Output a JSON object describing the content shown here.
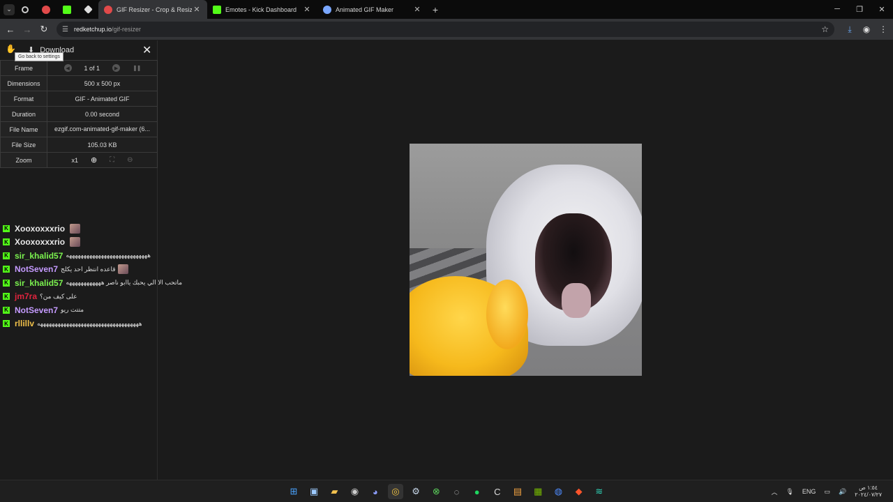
{
  "browser": {
    "tabs": [
      {
        "title": "GIF Resizer - Crop & Resize Anim",
        "active": true,
        "favicon_color": "#e14a4a"
      },
      {
        "title": "Emotes - Kick Dashboard",
        "active": false,
        "favicon_color": "#53fc18"
      },
      {
        "title": "Animated GIF Maker",
        "active": false,
        "favicon_color": "#7aa7ff"
      }
    ],
    "tab_close": "✕",
    "new_tab": "+",
    "url_host": "redketchup.io",
    "url_path": "/gif-resizer"
  },
  "panel": {
    "download_label": "Download",
    "tooltip": "Go back to settings",
    "rows": {
      "frame": {
        "label": "Frame",
        "value": "1 of 1"
      },
      "dimensions": {
        "label": "Dimensions",
        "value": "500 x 500 px"
      },
      "format": {
        "label": "Format",
        "value": "GIF - Animated GIF"
      },
      "duration": {
        "label": "Duration",
        "value": "0.00 second"
      },
      "filename": {
        "label": "File Name",
        "value": "ezgif.com-animated-gif-maker (6..."
      },
      "filesize": {
        "label": "File Size",
        "value": "105.03 KB"
      },
      "zoom": {
        "label": "Zoom",
        "value": "x1"
      }
    }
  },
  "chat": [
    {
      "user": "Xooxoxxxrio",
      "color": "#e8e8e8",
      "message": "",
      "emote": true
    },
    {
      "user": "Xooxoxxxrio",
      "color": "#e8e8e8",
      "message": "",
      "emote": true
    },
    {
      "user": "sir_khalid57",
      "color": "#7bf24f",
      "message": "ههههههههههههههههههههههههههههه",
      "emote": false
    },
    {
      "user": "NotSeven7",
      "color": "#c59bff",
      "message": "قاعده انتظر احد يكلج",
      "emote": true
    },
    {
      "user": "sir_khalid57",
      "color": "#7bf24f",
      "message": "ماتحب الا الي يحبك ياابو ناصر ههههههههههههه",
      "emote": false
    },
    {
      "user": "jm7ra",
      "color": "#e0243e",
      "message": "على كيف من؟",
      "emote": false
    },
    {
      "user": "NotSeven7",
      "color": "#c59bff",
      "message": "متتت ريو",
      "emote": false
    },
    {
      "user": "rllillv",
      "color": "#f0c04a",
      "message": "هههههههههههههههههههههههههههههههههههه",
      "emote": false
    }
  ],
  "taskbar": {
    "lang": "ENG",
    "time": "١:٥٤ ص",
    "date": "٢٠٢٤/٠٧/٢٧"
  }
}
